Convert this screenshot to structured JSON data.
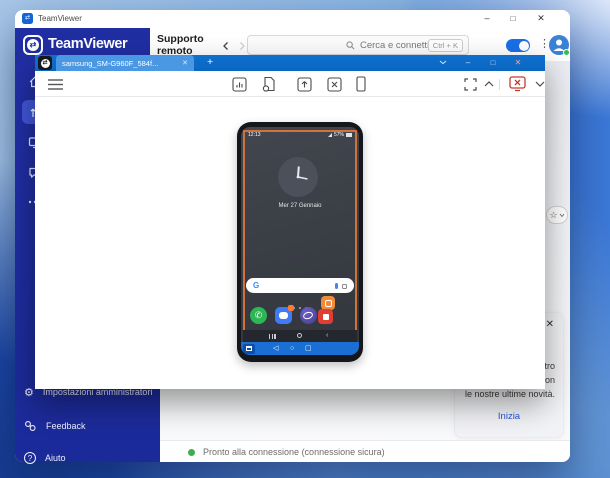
{
  "os_titlebar": {
    "title": "TeamViewer"
  },
  "header": {
    "brand": "TeamViewer",
    "page_title": "Supporto remoto",
    "search": {
      "placeholder": "Cerca e connetti",
      "shortcut": "Ctrl + K"
    }
  },
  "sidebar": {
    "bottom_items": [
      {
        "label": "Impostazioni amministratori"
      },
      {
        "label": "Feedback"
      },
      {
        "label": "Aiuto"
      }
    ]
  },
  "session": {
    "tab_title": "samsung_SM-G960F_584f..."
  },
  "phone": {
    "time": "12:13",
    "battery": "57%",
    "date": "Mer 27 Gennaio",
    "google_g": "G"
  },
  "notification": {
    "lines": [
      "entro",
      "asso con",
      "le nostre ultime novità."
    ],
    "action_label": "Inizia"
  },
  "status_bar": {
    "text": "Pronto alla connessione (connessione sicura)"
  },
  "glyphs": {
    "minimize": "–",
    "maximize": "□",
    "close": "✕",
    "plus": "+",
    "kebab": "⋮",
    "star": "☆",
    "arrows": "⇄",
    "question": "?",
    "gear": "⚙",
    "tv_back": "◁",
    "tv_home": "○",
    "tv_recents": "▢",
    "phone_glyph": "✆"
  },
  "colors": {
    "brand_navy": "#202ea3",
    "session_blue": "#0b68c5",
    "accent_blue": "#1a6fe8",
    "alert_red": "#c43a2d",
    "ok_green": "#3fae4f",
    "remote_frame_orange": "#d2713a"
  }
}
